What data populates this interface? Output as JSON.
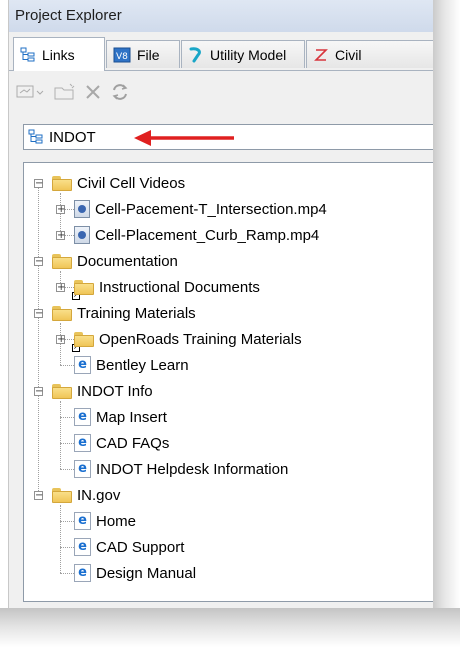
{
  "window": {
    "title": "Project Explorer"
  },
  "tabs": [
    {
      "label": "Links",
      "icon": "links-tree-icon",
      "active": true
    },
    {
      "label": "File",
      "icon": "file-icon",
      "active": false
    },
    {
      "label": "Utility Model",
      "icon": "utility-model-icon",
      "active": false
    },
    {
      "label": "Civil",
      "icon": "civil-icon",
      "active": false
    }
  ],
  "toolbar": {
    "buttons": [
      "add-link-icon",
      "new-folder-icon",
      "delete-icon",
      "refresh-icon"
    ]
  },
  "address": {
    "label": "INDOT",
    "icon": "links-tree-icon"
  },
  "annotation": {
    "arrow_color": "#e02020"
  },
  "tree": {
    "items": [
      {
        "label": "Civil Cell Videos",
        "type": "folder"
      },
      {
        "label": "Cell-Pacement-T_Intersection.mp4",
        "type": "media"
      },
      {
        "label": "Cell-Placement_Curb_Ramp.mp4",
        "type": "media"
      },
      {
        "label": "Documentation",
        "type": "folder"
      },
      {
        "label": "Instructional Documents",
        "type": "folder-shortcut"
      },
      {
        "label": "Training Materials",
        "type": "folder"
      },
      {
        "label": "OpenRoads Training Materials",
        "type": "folder-shortcut"
      },
      {
        "label": "Bentley Learn",
        "type": "link"
      },
      {
        "label": "INDOT Info",
        "type": "folder"
      },
      {
        "label": "Map Insert",
        "type": "link"
      },
      {
        "label": "CAD FAQs",
        "type": "link"
      },
      {
        "label": "INDOT Helpdesk Information",
        "type": "link"
      },
      {
        "label": "IN.gov",
        "type": "folder"
      },
      {
        "label": "Home",
        "type": "link"
      },
      {
        "label": "CAD Support",
        "type": "link"
      },
      {
        "label": "Design Manual",
        "type": "link"
      }
    ]
  },
  "colors": {
    "title_bar": "#d6e0ee",
    "folder": "#f3cf6b",
    "link_icon": "#1a6fd0",
    "arrow": "#e02020"
  }
}
